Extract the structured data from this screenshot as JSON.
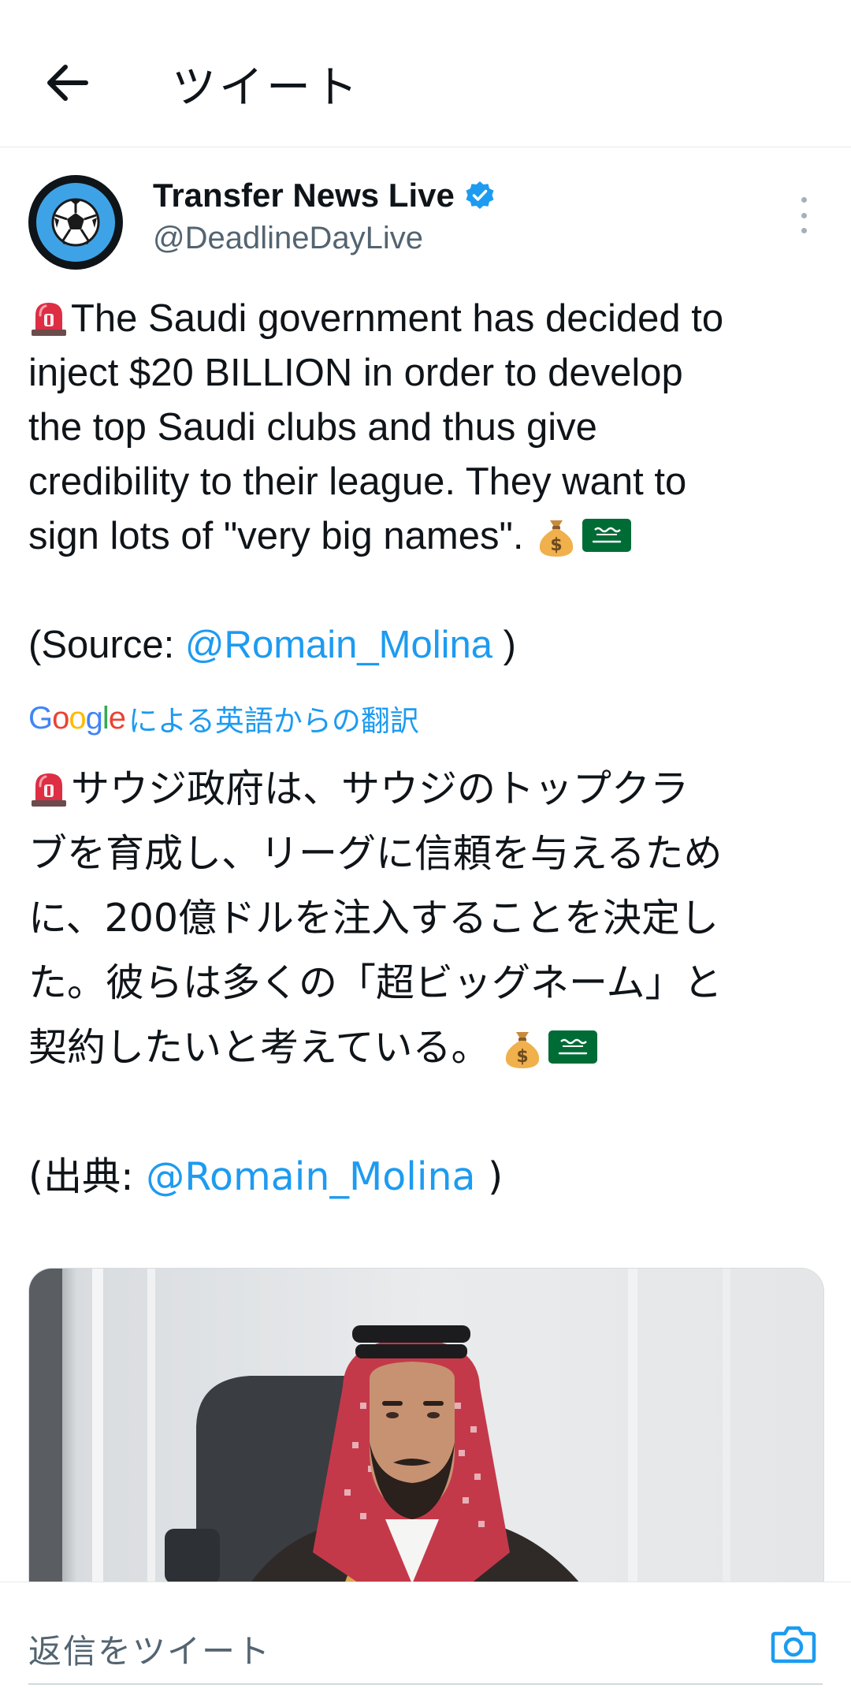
{
  "header": {
    "title": "ツイート"
  },
  "author": {
    "name": "Transfer News Live",
    "handle": "@DeadlineDayLive",
    "verified": true
  },
  "tweet": {
    "lines": [
      "The Saudi government has decided to",
      "inject $20 BILLION in order to develop",
      "the top Saudi clubs and thus give",
      "credibility to their league. They want to",
      "sign lots of \"very big names\"."
    ],
    "source_prefix": "(Source: ",
    "source_link": "@Romain_Molina",
    "source_suffix": " )"
  },
  "translation": {
    "google_logo": "Google",
    "label": "による英語からの翻訳",
    "lines": [
      "サウジ政府は、サウジのトップクラ",
      "ブを育成し、リーグに信頼を与えるため",
      "に、200億ドルを注入することを決定し",
      "た。彼らは多くの「超ビッグネーム」と",
      "契約したいと考えている。"
    ],
    "source_prefix": "(出典: ",
    "source_link": "@Romain_Molina",
    "source_suffix": " )"
  },
  "reply": {
    "placeholder": "返信をツイート"
  },
  "colors": {
    "accent": "#1d9bf0",
    "text": "#0f1419",
    "secondary": "#536471"
  },
  "icons": {
    "back": "arrow-left-icon",
    "verified": "verified-badge-icon",
    "more": "more-vertical-icon",
    "siren": "siren-emoji-icon",
    "money_bag": "money-bag-emoji-icon",
    "flag": "saudi-flag-emoji-icon",
    "camera": "camera-icon"
  }
}
